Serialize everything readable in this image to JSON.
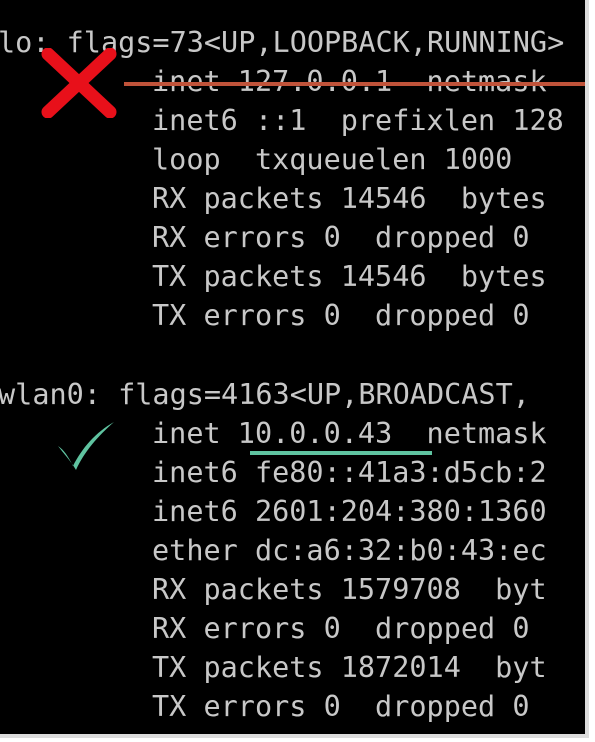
{
  "terminal": {
    "lo": {
      "header": "lo: flags=73<UP,LOOPBACK,RUNNING>",
      "inet": "inet 127.0.0.1  netmask",
      "inet6": "inet6 ::1  prefixlen 128",
      "loop": "loop  txqueuelen 1000",
      "rx_packets": "RX packets 14546  bytes",
      "rx_errors": "RX errors 0  dropped 0",
      "tx_packets": "TX packets 14546  bytes",
      "tx_errors": "TX errors 0  dropped 0"
    },
    "wlan0": {
      "header": "wlan0: flags=4163<UP,BROADCAST,",
      "inet_prefix": "inet ",
      "inet_address": "10.0.0.43",
      "inet_suffix": "  netmask",
      "inet6_link": "inet6 fe80::41a3:d5cb:2",
      "inet6_global": "inet6 2601:204:380:1360",
      "ether": "ether dc:a6:32:b0:43:ec",
      "rx_packets": "RX packets 1579708  byt",
      "rx_errors": "RX errors 0  dropped 0",
      "tx_packets": "TX packets 1872014  byt",
      "tx_errors": "TX errors 0  dropped 0"
    }
  },
  "annotations": {
    "wrong_icon": "cross-icon",
    "wrong_color": "#e8101a",
    "strike_color": "#c0533a",
    "correct_icon": "check-icon",
    "correct_color": "#5fc3a0",
    "underline_color": "#5fc3a0"
  },
  "colors": {
    "background": "#000000",
    "text": "#c8c8c8",
    "frame": "#dcdcdc"
  }
}
